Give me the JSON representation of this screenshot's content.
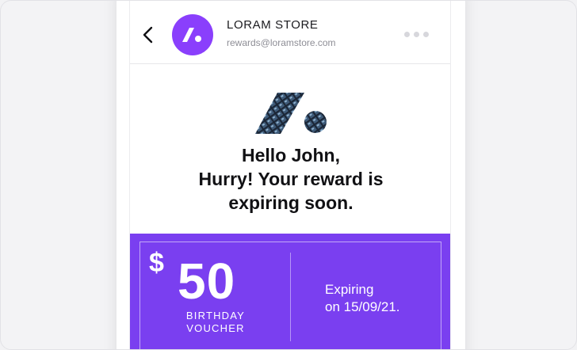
{
  "header": {
    "sender_name": "LORAM STORE",
    "sender_email": "rewards@loramstore.com",
    "back_icon": "chevron-left-icon",
    "more_icon": "more-horizontal-icon"
  },
  "email": {
    "greeting_line1": "Hello John,",
    "greeting_line2": "Hurry! Your reward is",
    "greeting_line3": "expiring soon."
  },
  "voucher": {
    "currency": "$",
    "amount": "50",
    "type_line1": "BIRTHDAY",
    "type_line2": "VOUCHER",
    "expiry_line1": "Expiring",
    "expiry_line2": "on 15/09/21."
  },
  "colors": {
    "brand": "#8a3ffc",
    "voucher_bg": "#7a3ff0"
  }
}
